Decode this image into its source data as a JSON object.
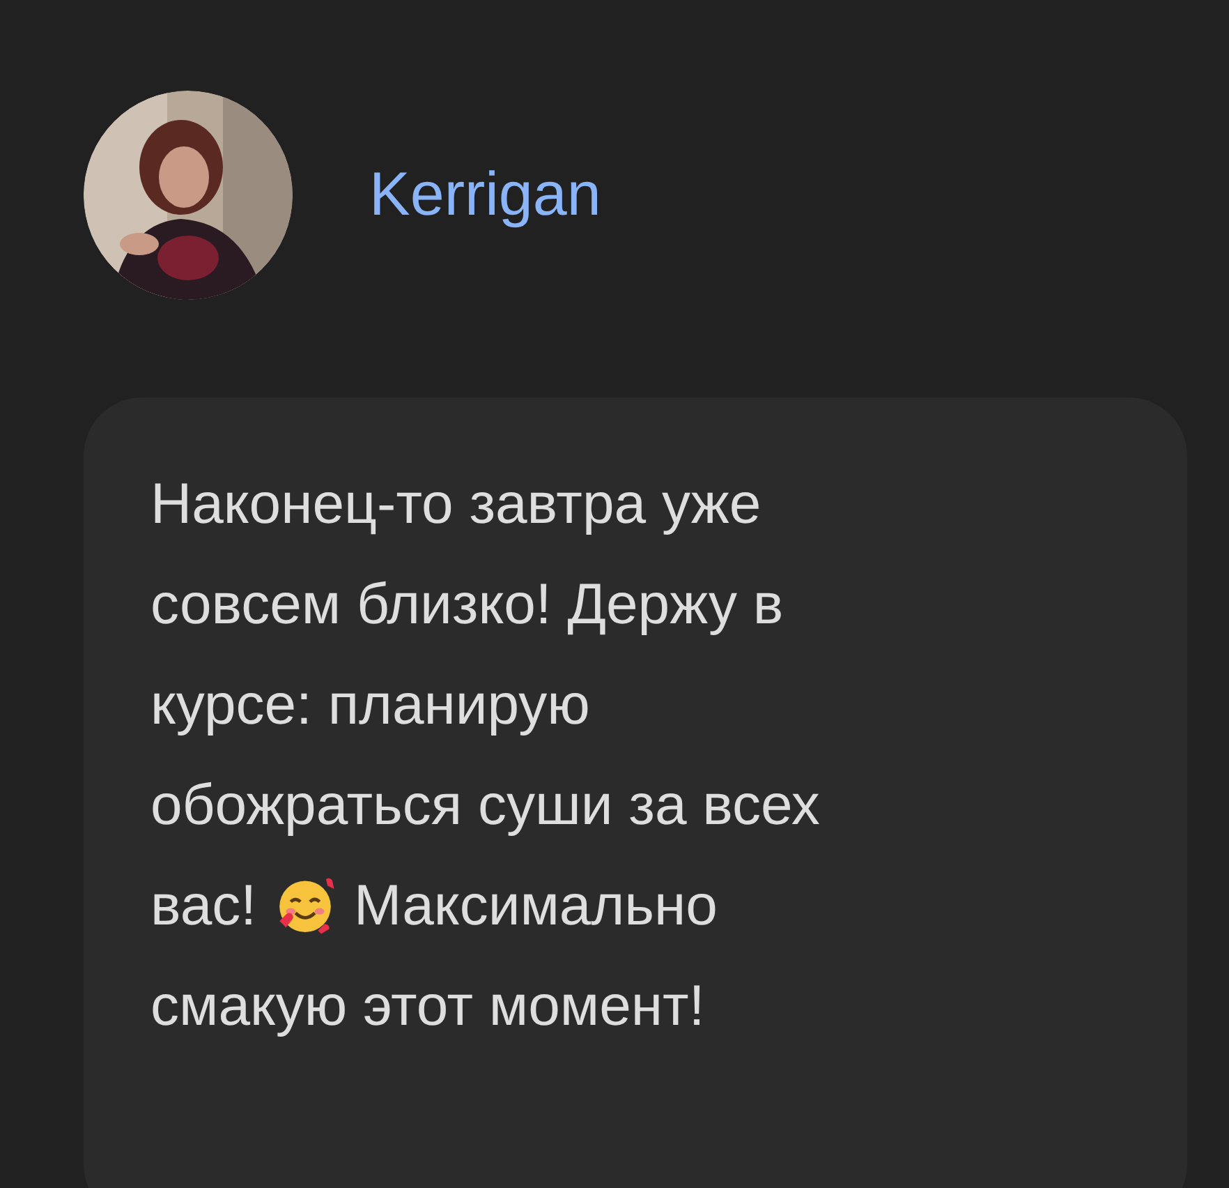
{
  "author": {
    "name": "Kerrigan"
  },
  "message": {
    "lines": [
      [
        {
          "kind": "text",
          "text": "Наконец-то завтра уже"
        }
      ],
      [
        {
          "kind": "text",
          "text": "совсем близко! Держу в"
        }
      ],
      [
        {
          "kind": "text",
          "text": "курсе: планирую"
        }
      ],
      [
        {
          "kind": "text",
          "text": "обожраться суши за всех"
        }
      ],
      [
        {
          "kind": "text",
          "text": "вас!"
        },
        {
          "kind": "emoji"
        },
        {
          "kind": "text",
          "text": "Максимально"
        }
      ],
      [
        {
          "kind": "text",
          "text": "смакую этот момент!"
        }
      ]
    ]
  }
}
